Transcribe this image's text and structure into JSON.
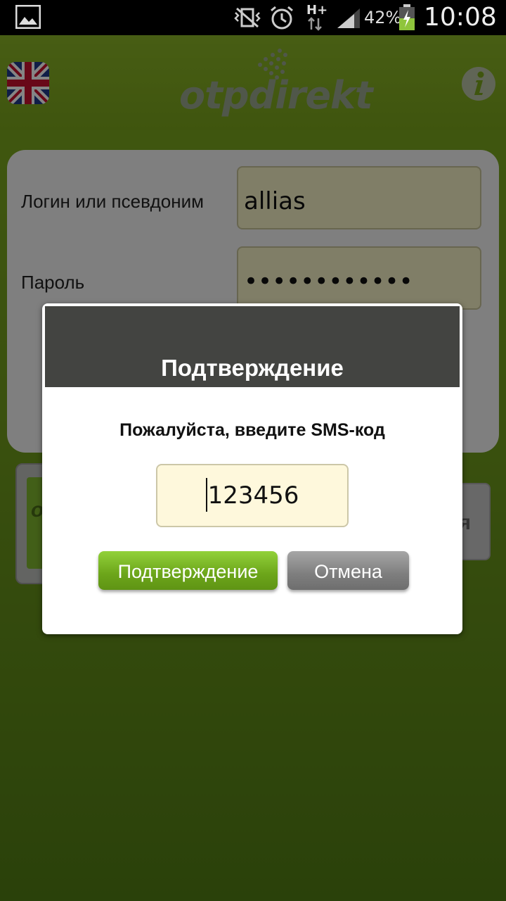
{
  "status_bar": {
    "gallery_icon": "image-notification-icon",
    "vibrate_icon": "vibrate-mute-icon",
    "alarm_icon": "alarm-clock-icon",
    "network_type": "H+",
    "signal_icon": "signal-strength-icon",
    "battery_percent": "42%",
    "battery_icon": "battery-charging-icon",
    "time": "10:08"
  },
  "header": {
    "language_flag": "uk-flag-icon",
    "logo": "otpdirekt",
    "info_icon": "info-icon",
    "accent_color": "#7fad1c"
  },
  "login_form": {
    "login_label": "Логин или псевдоним",
    "login_value": "allias",
    "password_label": "Пароль",
    "password_value": "••••••••••••"
  },
  "background_buttons": {
    "left_fragment": "o",
    "right_fragment": "я"
  },
  "dialog": {
    "title": "Подтверждение",
    "message": "Пожалуйста, введите SMS-код",
    "sms_code": "123456",
    "confirm_label": "Подтверждение",
    "cancel_label": "Отмена"
  }
}
